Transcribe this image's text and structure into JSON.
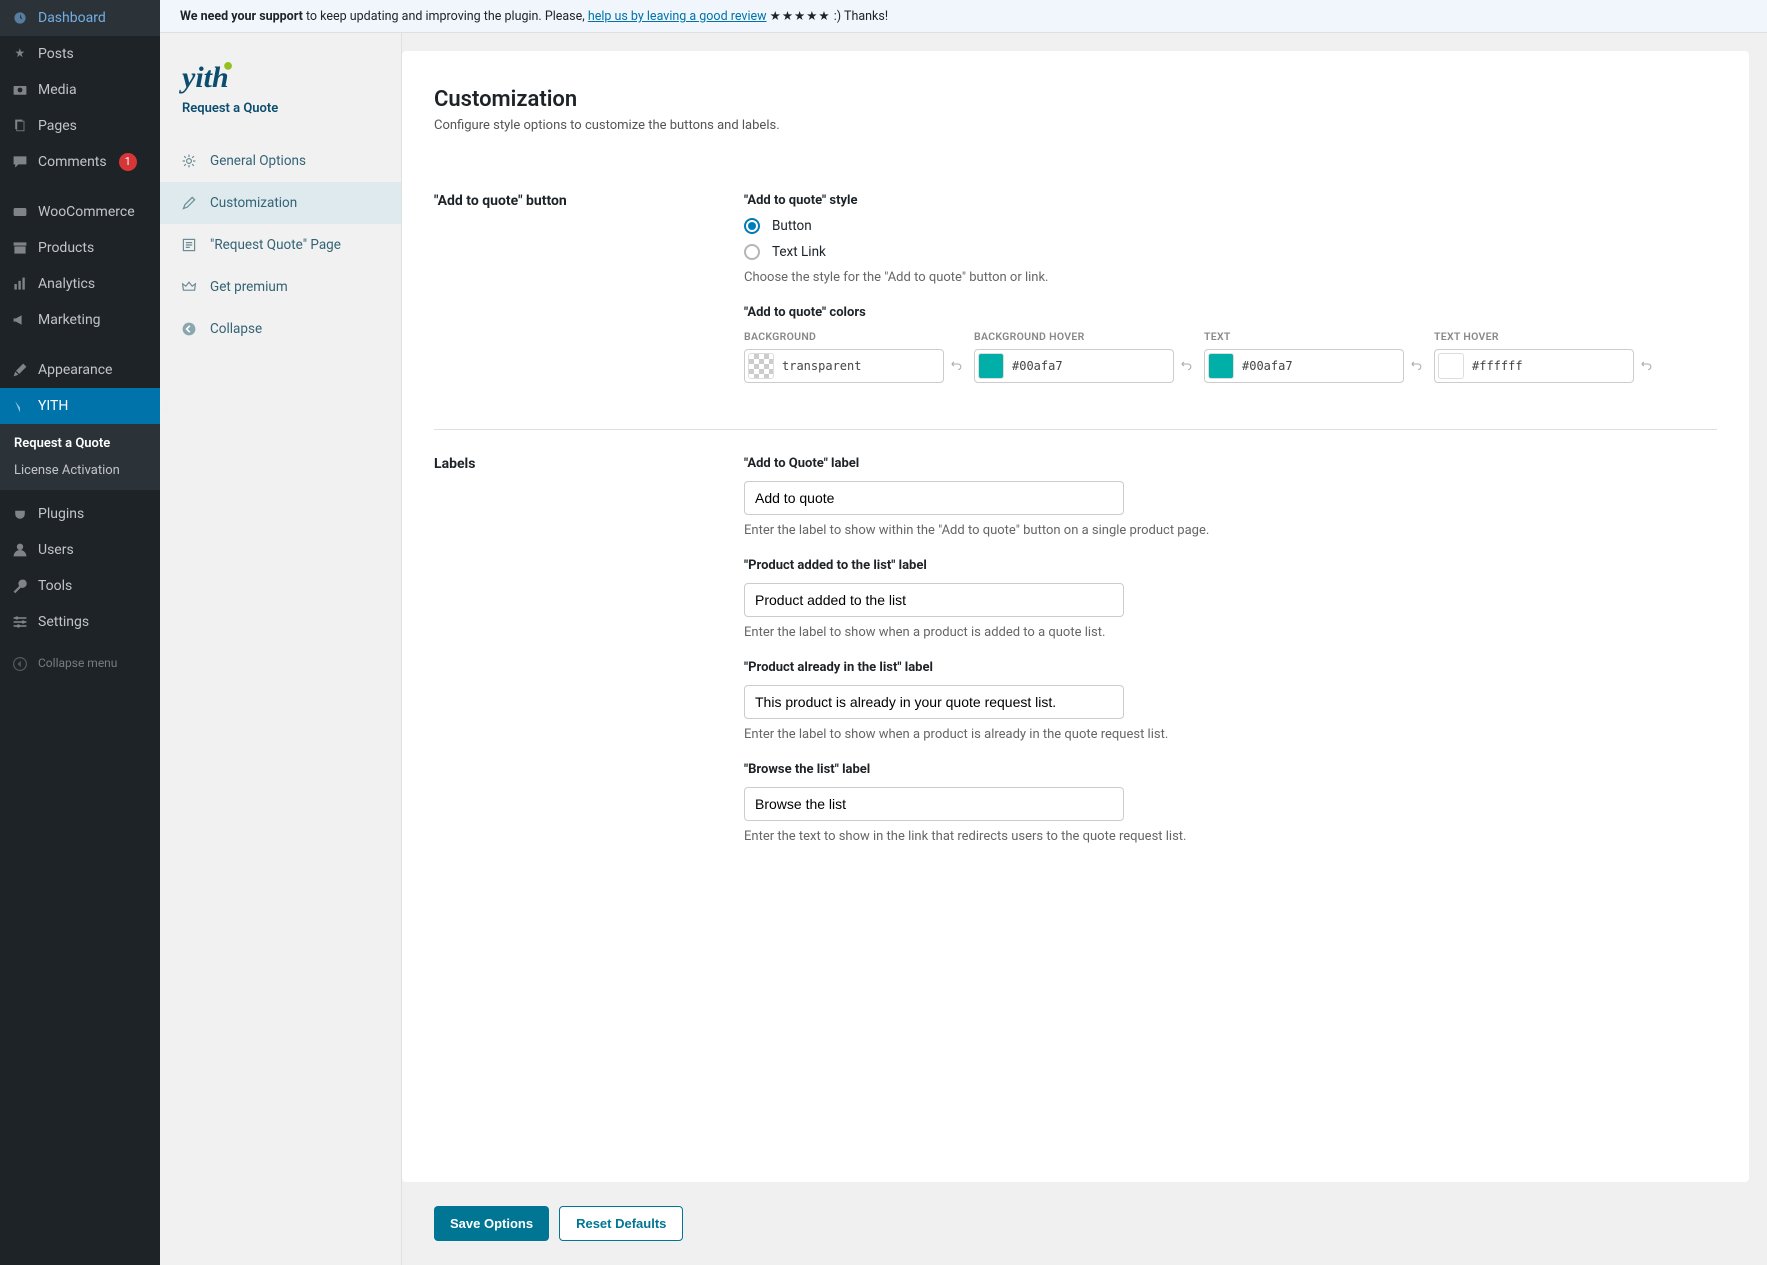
{
  "wp_sidebar": {
    "items": [
      {
        "label": "Dashboard",
        "icon": "gauge"
      },
      {
        "label": "Posts",
        "icon": "pin"
      },
      {
        "label": "Media",
        "icon": "camera"
      },
      {
        "label": "Pages",
        "icon": "page"
      },
      {
        "label": "Comments",
        "icon": "comment",
        "badge": "1"
      },
      {
        "label": "WooCommerce",
        "icon": "woo"
      },
      {
        "label": "Products",
        "icon": "archive"
      },
      {
        "label": "Analytics",
        "icon": "chart"
      },
      {
        "label": "Marketing",
        "icon": "megaphone"
      },
      {
        "label": "Appearance",
        "icon": "brush"
      },
      {
        "label": "YITH",
        "icon": "yith",
        "active": true
      },
      {
        "label": "Plugins",
        "icon": "plug"
      },
      {
        "label": "Users",
        "icon": "user"
      },
      {
        "label": "Tools",
        "icon": "wrench"
      },
      {
        "label": "Settings",
        "icon": "sliders"
      },
      {
        "label": "Collapse menu",
        "icon": "collapse"
      }
    ],
    "submenu": [
      {
        "label": "Request a Quote",
        "active": true
      },
      {
        "label": "License Activation"
      }
    ]
  },
  "notice": {
    "prefix": "We need your support ",
    "middle": "to keep updating and improving the plugin. Please, ",
    "link": "help us by leaving a good review",
    "stars": "★★★★★",
    "suffix": " :) Thanks!"
  },
  "yith": {
    "logo": "yith",
    "quote_label": "Request a Quote",
    "nav": [
      {
        "label": "General Options",
        "icon": "gear"
      },
      {
        "label": "Customization",
        "icon": "pen",
        "active": true
      },
      {
        "label": "\"Request Quote\" Page",
        "icon": "lines"
      },
      {
        "label": "Get premium",
        "icon": "crown"
      },
      {
        "label": "Collapse",
        "icon": "back"
      }
    ]
  },
  "panel": {
    "title": "Customization",
    "desc": "Configure style options to customize the buttons and labels."
  },
  "section_button": {
    "title": "\"Add to quote\" button",
    "style_label": "\"Add to quote\" style",
    "opt_button": "Button",
    "opt_link": "Text Link",
    "style_help": "Choose the style for the \"Add to quote\" button or link.",
    "colors_label": "\"Add to quote\" colors",
    "colors": [
      {
        "label": "BACKGROUND",
        "value": "transparent",
        "swatch": "checker"
      },
      {
        "label": "BACKGROUND HOVER",
        "value": "#00afa7",
        "swatch": "#00afa7"
      },
      {
        "label": "TEXT",
        "value": "#00afa7",
        "swatch": "#00afa7"
      },
      {
        "label": "TEXT HOVER",
        "value": "#ffffff",
        "swatch": "#ffffff"
      }
    ]
  },
  "section_labels": {
    "title": "Labels",
    "fields": [
      {
        "label": "\"Add to Quote\" label",
        "value": "Add to quote",
        "help": "Enter the label to show within the \"Add to quote\" button on a single product page."
      },
      {
        "label": "\"Product added to the list\" label",
        "value": "Product added to the list",
        "help": "Enter the label to show when a product is added to a quote list."
      },
      {
        "label": "\"Product already in the list\" label",
        "value": "This product is already in your quote request list.",
        "help": "Enter the label to show when a product is already in the quote request list."
      },
      {
        "label": "\"Browse the list\" label",
        "value": "Browse the list",
        "help": "Enter the text to show in the link that redirects users to the quote request list."
      }
    ]
  },
  "buttons": {
    "save": "Save Options",
    "reset": "Reset Defaults"
  }
}
